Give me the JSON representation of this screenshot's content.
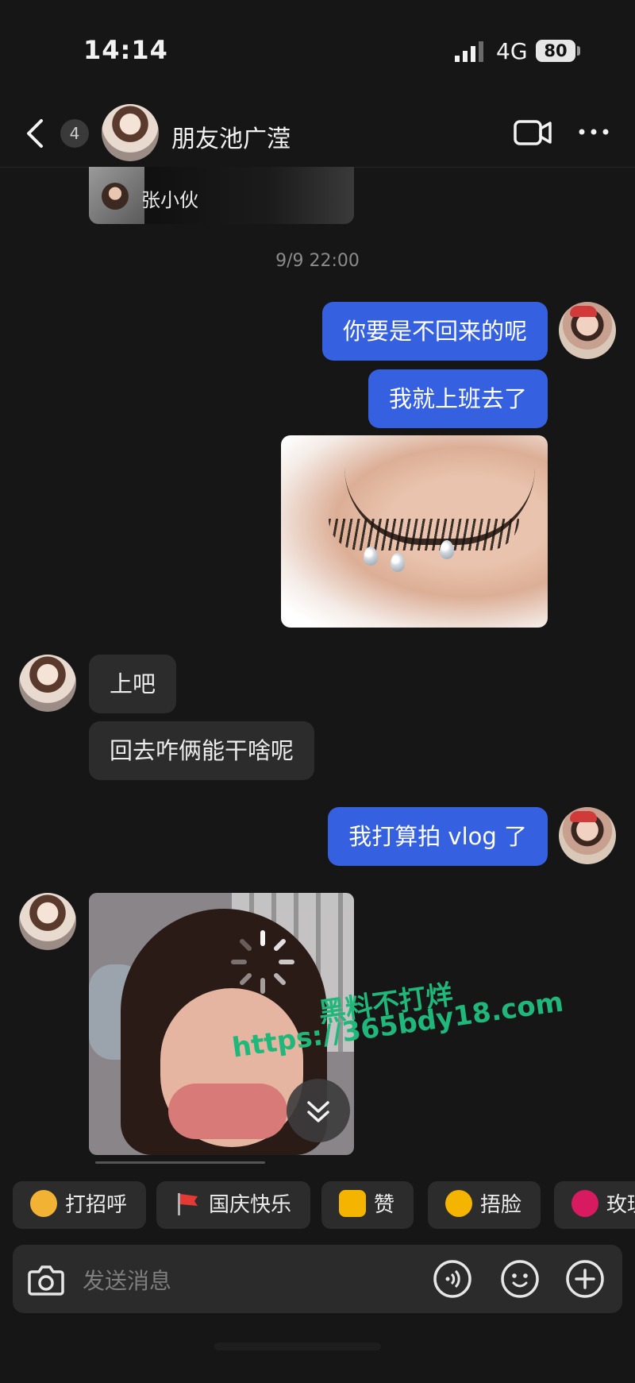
{
  "status_bar": {
    "time": "14:14",
    "network": "4G",
    "battery": "80"
  },
  "header": {
    "back_count": "4",
    "contact_name": "朋友池广滢"
  },
  "shared_card": {
    "name": "张小伙"
  },
  "timestamp": "9/9 22:00",
  "messages": [
    {
      "from": "me",
      "text": "你要是不回来的呢"
    },
    {
      "from": "me",
      "text": "我就上班去了"
    },
    {
      "from": "her",
      "text": "上吧"
    },
    {
      "from": "her",
      "text": "回去咋俩能干啥呢"
    },
    {
      "from": "me",
      "text": "我打算拍 vlog 了"
    }
  ],
  "watermark": {
    "line1": "黑料不打烊",
    "line2": "https://365bdy18.com"
  },
  "quick_replies": [
    {
      "label": "打招呼",
      "icon": "wave-emoji-icon",
      "color": "#f2b233"
    },
    {
      "label": "国庆快乐",
      "icon": "flag-icon",
      "color": "#e53935"
    },
    {
      "label": "赞",
      "icon": "thumbs-up-icon",
      "color": "#f4b400"
    },
    {
      "label": "捂脸",
      "icon": "facepalm-emoji-icon",
      "color": "#f4b400"
    },
    {
      "label": "玫瑰",
      "icon": "rose-icon",
      "color": "#d81b60"
    }
  ],
  "input": {
    "placeholder": "发送消息"
  }
}
